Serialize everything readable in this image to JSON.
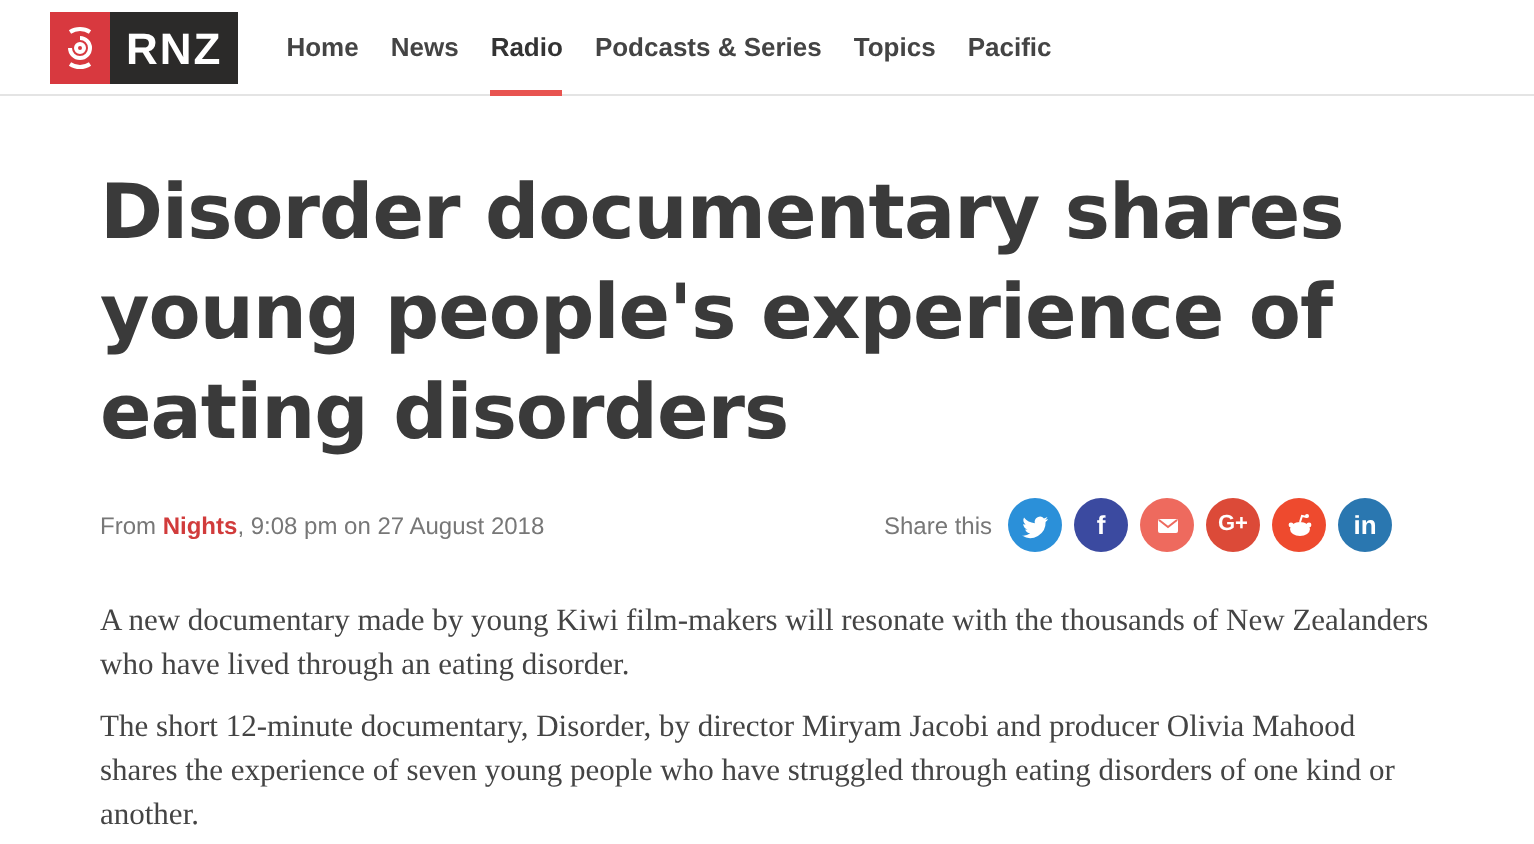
{
  "logo": {
    "text": "RNZ"
  },
  "nav": [
    {
      "label": "Home",
      "selected": false
    },
    {
      "label": "News",
      "selected": false
    },
    {
      "label": "Radio",
      "selected": true
    },
    {
      "label": "Podcasts & Series",
      "selected": false
    },
    {
      "label": "Topics",
      "selected": false
    },
    {
      "label": "Pacific",
      "selected": false
    }
  ],
  "headline": "Disorder documentary shares young people's experience of eating disorders",
  "byline": {
    "prefix": "From",
    "program": "Nights",
    "time": ", 9:08 pm on 27 August 2018"
  },
  "share": {
    "label": "Share this",
    "buttons": [
      {
        "kind": "twitter",
        "color": "#2b90d9"
      },
      {
        "kind": "facebook",
        "color": "#3b4aa0",
        "glyph": "f"
      },
      {
        "kind": "email",
        "color": "#ee6a5e"
      },
      {
        "kind": "googleplus",
        "color": "#dc4a38",
        "glyph": "G+"
      },
      {
        "kind": "reddit",
        "color": "#ee4a2e"
      },
      {
        "kind": "linkedin",
        "color": "#2a77b0",
        "glyph": "in"
      }
    ]
  },
  "paragraphs": [
    "A new documentary made by young Kiwi film-makers will resonate with the thousands of New Zealanders who have lived through an eating disorder.",
    "The short 12-minute documentary, Disorder, by director Miryam Jacobi and producer Olivia Mahood shares the experience of seven young people who have struggled through eating disorders of one kind or another."
  ]
}
